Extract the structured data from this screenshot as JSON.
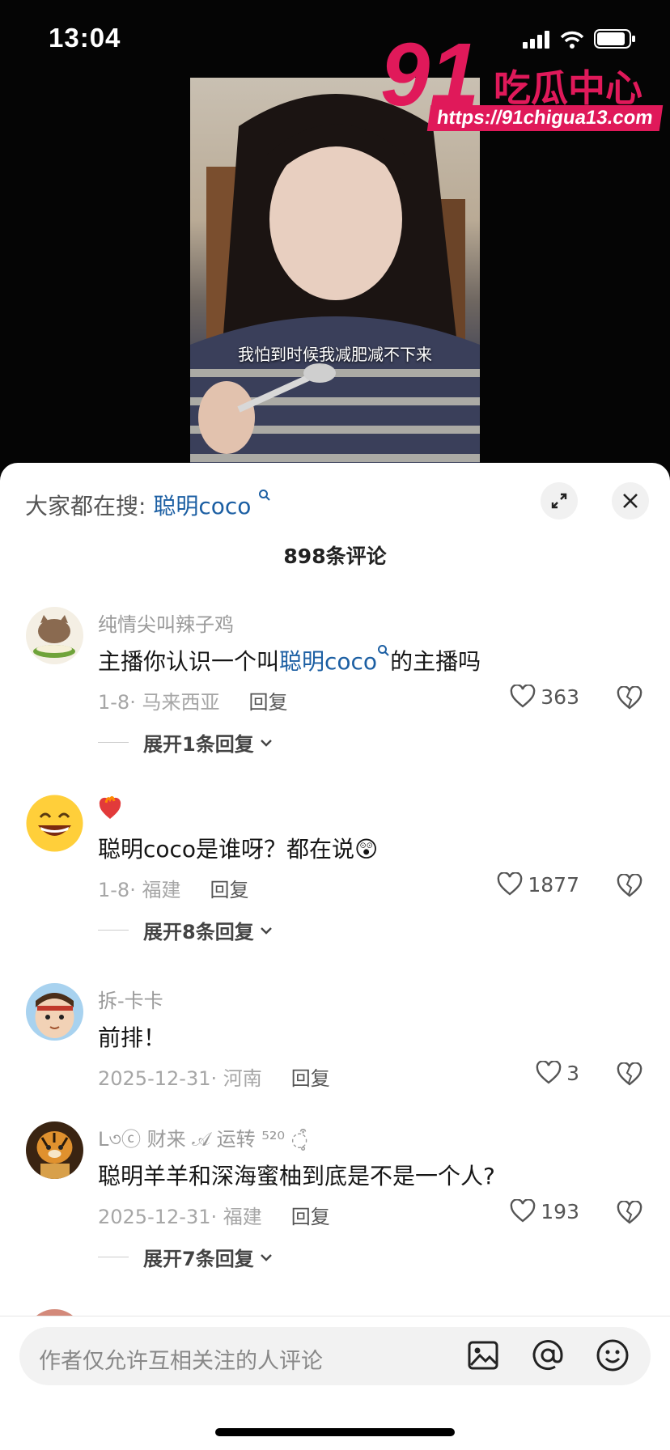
{
  "status": {
    "time": "13:04"
  },
  "watermark": {
    "brand_num": "91",
    "brand_text": "吃瓜中心",
    "url": "https://91chigua13.com"
  },
  "video": {
    "subtitle": "我怕到时候我减肥减不下来"
  },
  "sheet": {
    "search_prefix": "大家都在搜:",
    "search_keyword": "聪明coco",
    "comment_count": "898条评论",
    "expand_icon": "expand-icon",
    "close_icon": "close-icon"
  },
  "comments": [
    {
      "username": "纯情尖叫辣子鸡",
      "text_before": "主播你认识一个叫",
      "keyword": "聪明coco",
      "text_after": "的主播吗",
      "date": "1-8",
      "location": "马来西亚",
      "reply_label": "回复",
      "likes": "363",
      "expand": "展开1条回复"
    },
    {
      "username": "❤️‍🔥",
      "text": "聪明coco是谁呀？都在说😲",
      "date": "1-8",
      "location": "福建",
      "reply_label": "回复",
      "likes": "1877",
      "expand": "展开8条回复"
    },
    {
      "username": "拆-卡卡",
      "text": "前排！",
      "date": "2025-12-31",
      "location": "河南",
      "reply_label": "回复",
      "likes": "3"
    },
    {
      "username": "L৩ⓒ 财来 𝒜 运转 ⁵²⁰ ◌̥͒",
      "text": "聪明羊羊和深海蜜柚到底是不是一个人?",
      "date": "2025-12-31",
      "location": "福建",
      "reply_label": "回复",
      "likes": "193",
      "expand": "展开7条回复"
    }
  ],
  "input": {
    "placeholder": "作者仅允许互相关注的人评论"
  }
}
